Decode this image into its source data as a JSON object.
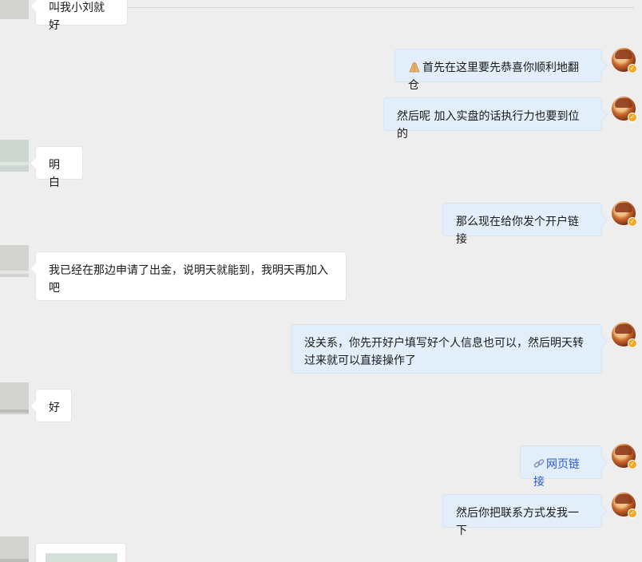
{
  "messages": [
    {
      "side": "left",
      "text": "叫我小刘就好"
    },
    {
      "side": "right",
      "text": "首先在这里要先恭喜你顺利地翻仓",
      "emoji": "folded-hands"
    },
    {
      "side": "right",
      "text": "然后呢 加入实盘的话执行力也要到位的"
    },
    {
      "side": "left",
      "text": "明白"
    },
    {
      "side": "right",
      "text": "那么现在给你发个开户链接"
    },
    {
      "side": "left",
      "text": "我已经在那边申请了出金，说明天就能到，我明天再加入吧"
    },
    {
      "side": "right",
      "text": "没关系，你先开好户填写好个人信息也可以，然后明天转过来就可以直接操作了"
    },
    {
      "side": "left",
      "text": "好"
    },
    {
      "side": "right",
      "text": "网页链接",
      "type": "link"
    },
    {
      "side": "right",
      "text": "然后你把联系方式发我一下"
    }
  ],
  "icons": {
    "avatar_badge": "verified-badge-icon",
    "link": "link-icon",
    "emoji": "folded-hands-icon"
  },
  "colors": {
    "background": "#eeeeee",
    "bubble_left": "#ffffff",
    "bubble_right": "#e2eef9",
    "link": "#2a5bd7",
    "badge": "#f5a623"
  }
}
